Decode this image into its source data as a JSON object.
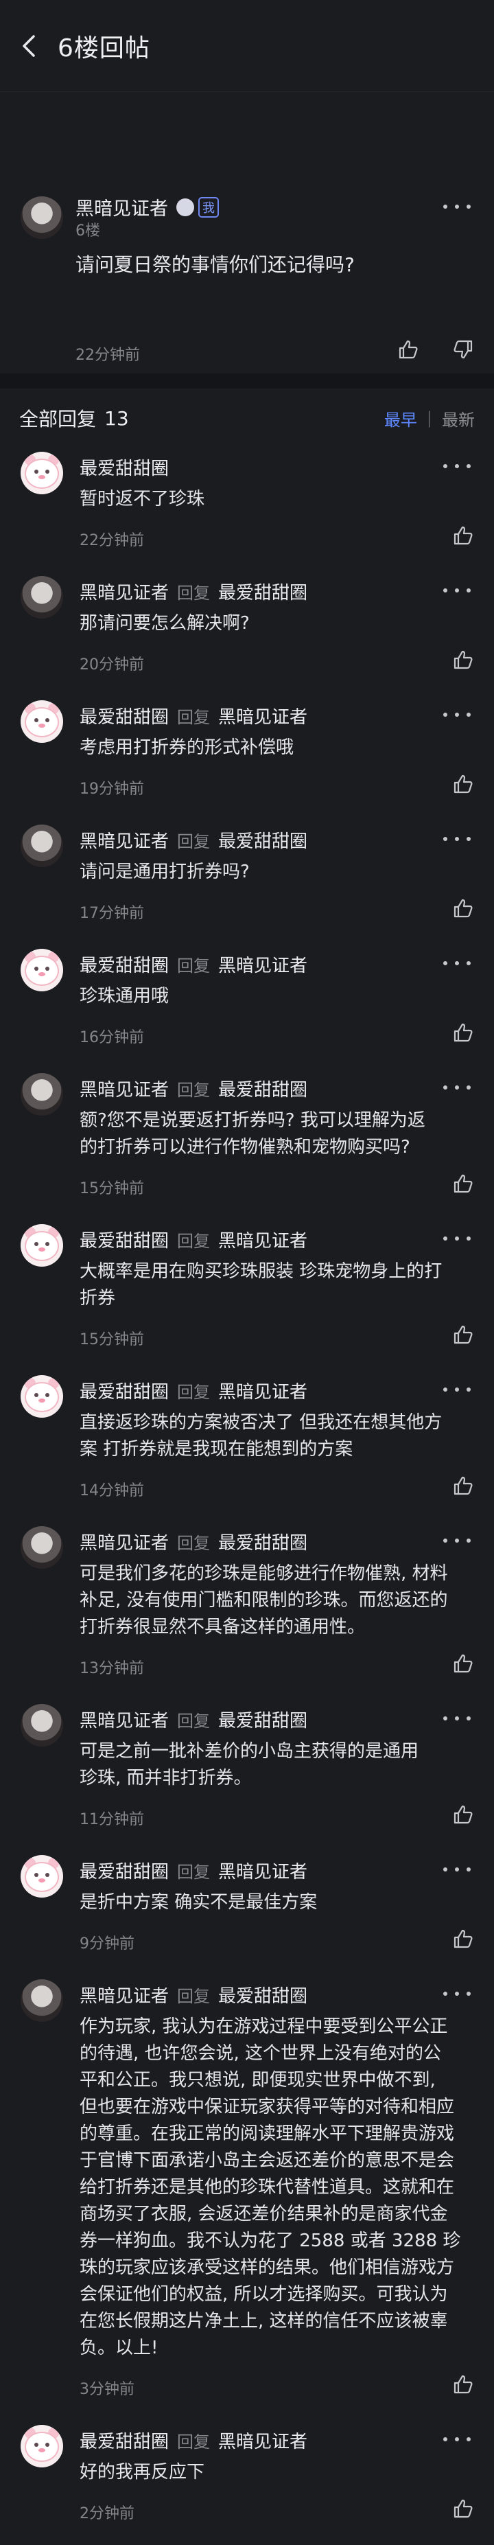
{
  "header": {
    "title": "6楼回帖"
  },
  "post": {
    "author": "黑暗见证者",
    "me_badge": "我",
    "floor": "6楼",
    "content": "请问夏日祭的事情你们还记得吗?",
    "time": "22分钟前"
  },
  "replies_header": {
    "label": "全部回复",
    "count": "13",
    "sort_active": "最早",
    "sort_inactive": "最新"
  },
  "reply_prefix": "回复",
  "replies": [
    {
      "author": "最爱甜甜圈",
      "target": "",
      "avatar": "pink",
      "time": "22分钟前",
      "lines": [
        "暂时返不了珍珠"
      ]
    },
    {
      "author": "黑暗见证者",
      "target": "最爱甜甜圈",
      "avatar": "dark",
      "time": "20分钟前",
      "lines": [
        "那请问要怎么解决啊?"
      ]
    },
    {
      "author": "最爱甜甜圈",
      "target": "黑暗见证者",
      "avatar": "pink",
      "time": "19分钟前",
      "lines": [
        "考虑用打折券的形式补偿哦"
      ]
    },
    {
      "author": "黑暗见证者",
      "target": "最爱甜甜圈",
      "avatar": "dark",
      "time": "17分钟前",
      "lines": [
        "请问是通用打折券吗?"
      ]
    },
    {
      "author": "最爱甜甜圈",
      "target": "黑暗见证者",
      "avatar": "pink",
      "time": "16分钟前",
      "lines": [
        "珍珠通用哦"
      ]
    },
    {
      "author": "黑暗见证者",
      "target": "最爱甜甜圈",
      "avatar": "dark",
      "time": "15分钟前",
      "lines": [
        "额?您不是说要返打折券吗? 我可以理解为返",
        "的打折券可以进行作物催熟和宠物购买吗?"
      ]
    },
    {
      "author": "最爱甜甜圈",
      "target": "黑暗见证者",
      "avatar": "pink",
      "time": "15分钟前",
      "lines": [
        "大概率是用在购买珍珠服装 珍珠宠物身上的打",
        "折券"
      ]
    },
    {
      "author": "最爱甜甜圈",
      "target": "黑暗见证者",
      "avatar": "pink",
      "time": "14分钟前",
      "lines": [
        "直接返珍珠的方案被否决了 但我还在想其他方",
        "案 打折券就是我现在能想到的方案"
      ]
    },
    {
      "author": "黑暗见证者",
      "target": "最爱甜甜圈",
      "avatar": "dark",
      "time": "13分钟前",
      "lines": [
        "可是我们多花的珍珠是能够进行作物催熟, 材料",
        "补足, 没有使用门槛和限制的珍珠。而您返还的",
        "打折券很显然不具备这样的通用性。"
      ]
    },
    {
      "author": "黑暗见证者",
      "target": "最爱甜甜圈",
      "avatar": "dark",
      "time": "11分钟前",
      "lines": [
        "可是之前一批补差价的小岛主获得的是通用",
        "珍珠, 而并非打折券。"
      ]
    },
    {
      "author": "最爱甜甜圈",
      "target": "黑暗见证者",
      "avatar": "pink",
      "time": "9分钟前",
      "lines": [
        "是折中方案 确实不是最佳方案"
      ]
    },
    {
      "author": "黑暗见证者",
      "target": "最爱甜甜圈",
      "avatar": "dark",
      "time": "3分钟前",
      "lines": [
        "作为玩家, 我认为在游戏过程中要受到公平公正",
        "的待遇, 也许您会说, 这个世界上没有绝对的公",
        "平和公正。我只想说, 即便现实世界中做不到,",
        "但也要在游戏中保证玩家获得平等的对待和相应",
        "的尊重。在我正常的阅读理解水平下理解贵游戏",
        "于官博下面承诺小岛主会返还差价的意思不是会",
        "给打折券还是其他的珍珠代替性道具。这就和在",
        "商场买了衣服, 会返还差价结果补的是商家代金",
        "券一样狗血。我不认为花了 2588 或者 3288 珍",
        "珠的玩家应该承受这样的结果。他们相信游戏方",
        "会保证他们的权益, 所以才选择购买。可我认为",
        "在您长假期这片净土上, 这样的信任不应该被辜",
        "负。以上!"
      ]
    },
    {
      "author": "最爱甜甜圈",
      "target": "黑暗见证者",
      "avatar": "pink",
      "time": "2分钟前",
      "lines": [
        "好的我再反应下"
      ]
    }
  ]
}
